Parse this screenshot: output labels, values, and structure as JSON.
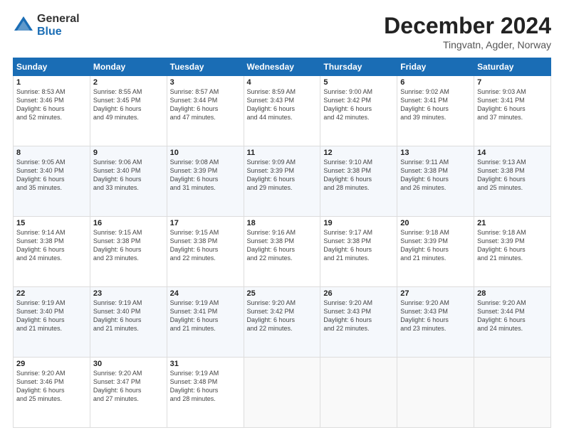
{
  "logo": {
    "general": "General",
    "blue": "Blue"
  },
  "header": {
    "month": "December 2024",
    "location": "Tingvatn, Agder, Norway"
  },
  "weekdays": [
    "Sunday",
    "Monday",
    "Tuesday",
    "Wednesday",
    "Thursday",
    "Friday",
    "Saturday"
  ],
  "weeks": [
    [
      {
        "day": "1",
        "info": "Sunrise: 8:53 AM\nSunset: 3:46 PM\nDaylight: 6 hours\nand 52 minutes."
      },
      {
        "day": "2",
        "info": "Sunrise: 8:55 AM\nSunset: 3:45 PM\nDaylight: 6 hours\nand 49 minutes."
      },
      {
        "day": "3",
        "info": "Sunrise: 8:57 AM\nSunset: 3:44 PM\nDaylight: 6 hours\nand 47 minutes."
      },
      {
        "day": "4",
        "info": "Sunrise: 8:59 AM\nSunset: 3:43 PM\nDaylight: 6 hours\nand 44 minutes."
      },
      {
        "day": "5",
        "info": "Sunrise: 9:00 AM\nSunset: 3:42 PM\nDaylight: 6 hours\nand 42 minutes."
      },
      {
        "day": "6",
        "info": "Sunrise: 9:02 AM\nSunset: 3:41 PM\nDaylight: 6 hours\nand 39 minutes."
      },
      {
        "day": "7",
        "info": "Sunrise: 9:03 AM\nSunset: 3:41 PM\nDaylight: 6 hours\nand 37 minutes."
      }
    ],
    [
      {
        "day": "8",
        "info": "Sunrise: 9:05 AM\nSunset: 3:40 PM\nDaylight: 6 hours\nand 35 minutes."
      },
      {
        "day": "9",
        "info": "Sunrise: 9:06 AM\nSunset: 3:40 PM\nDaylight: 6 hours\nand 33 minutes."
      },
      {
        "day": "10",
        "info": "Sunrise: 9:08 AM\nSunset: 3:39 PM\nDaylight: 6 hours\nand 31 minutes."
      },
      {
        "day": "11",
        "info": "Sunrise: 9:09 AM\nSunset: 3:39 PM\nDaylight: 6 hours\nand 29 minutes."
      },
      {
        "day": "12",
        "info": "Sunrise: 9:10 AM\nSunset: 3:38 PM\nDaylight: 6 hours\nand 28 minutes."
      },
      {
        "day": "13",
        "info": "Sunrise: 9:11 AM\nSunset: 3:38 PM\nDaylight: 6 hours\nand 26 minutes."
      },
      {
        "day": "14",
        "info": "Sunrise: 9:13 AM\nSunset: 3:38 PM\nDaylight: 6 hours\nand 25 minutes."
      }
    ],
    [
      {
        "day": "15",
        "info": "Sunrise: 9:14 AM\nSunset: 3:38 PM\nDaylight: 6 hours\nand 24 minutes."
      },
      {
        "day": "16",
        "info": "Sunrise: 9:15 AM\nSunset: 3:38 PM\nDaylight: 6 hours\nand 23 minutes."
      },
      {
        "day": "17",
        "info": "Sunrise: 9:15 AM\nSunset: 3:38 PM\nDaylight: 6 hours\nand 22 minutes."
      },
      {
        "day": "18",
        "info": "Sunrise: 9:16 AM\nSunset: 3:38 PM\nDaylight: 6 hours\nand 22 minutes."
      },
      {
        "day": "19",
        "info": "Sunrise: 9:17 AM\nSunset: 3:38 PM\nDaylight: 6 hours\nand 21 minutes."
      },
      {
        "day": "20",
        "info": "Sunrise: 9:18 AM\nSunset: 3:39 PM\nDaylight: 6 hours\nand 21 minutes."
      },
      {
        "day": "21",
        "info": "Sunrise: 9:18 AM\nSunset: 3:39 PM\nDaylight: 6 hours\nand 21 minutes."
      }
    ],
    [
      {
        "day": "22",
        "info": "Sunrise: 9:19 AM\nSunset: 3:40 PM\nDaylight: 6 hours\nand 21 minutes."
      },
      {
        "day": "23",
        "info": "Sunrise: 9:19 AM\nSunset: 3:40 PM\nDaylight: 6 hours\nand 21 minutes."
      },
      {
        "day": "24",
        "info": "Sunrise: 9:19 AM\nSunset: 3:41 PM\nDaylight: 6 hours\nand 21 minutes."
      },
      {
        "day": "25",
        "info": "Sunrise: 9:20 AM\nSunset: 3:42 PM\nDaylight: 6 hours\nand 22 minutes."
      },
      {
        "day": "26",
        "info": "Sunrise: 9:20 AM\nSunset: 3:43 PM\nDaylight: 6 hours\nand 22 minutes."
      },
      {
        "day": "27",
        "info": "Sunrise: 9:20 AM\nSunset: 3:43 PM\nDaylight: 6 hours\nand 23 minutes."
      },
      {
        "day": "28",
        "info": "Sunrise: 9:20 AM\nSunset: 3:44 PM\nDaylight: 6 hours\nand 24 minutes."
      }
    ],
    [
      {
        "day": "29",
        "info": "Sunrise: 9:20 AM\nSunset: 3:46 PM\nDaylight: 6 hours\nand 25 minutes."
      },
      {
        "day": "30",
        "info": "Sunrise: 9:20 AM\nSunset: 3:47 PM\nDaylight: 6 hours\nand 27 minutes."
      },
      {
        "day": "31",
        "info": "Sunrise: 9:19 AM\nSunset: 3:48 PM\nDaylight: 6 hours\nand 28 minutes."
      },
      {
        "day": "",
        "info": ""
      },
      {
        "day": "",
        "info": ""
      },
      {
        "day": "",
        "info": ""
      },
      {
        "day": "",
        "info": ""
      }
    ]
  ]
}
